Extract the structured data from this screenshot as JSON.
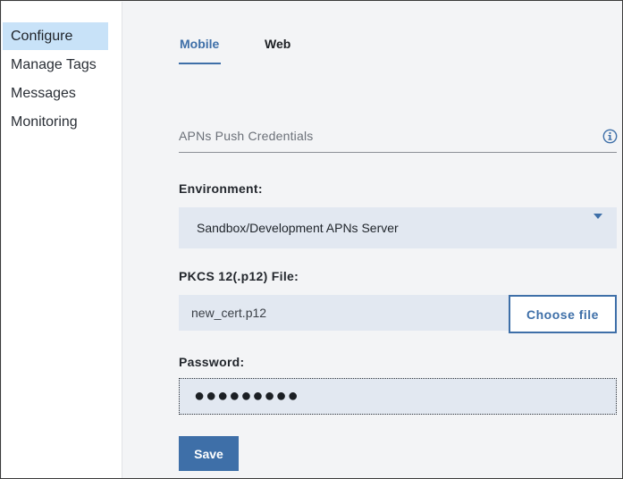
{
  "sidebar": {
    "items": [
      {
        "label": "Configure",
        "active": true
      },
      {
        "label": "Manage Tags",
        "active": false
      },
      {
        "label": "Messages",
        "active": false
      },
      {
        "label": "Monitoring",
        "active": false
      }
    ]
  },
  "tabs": [
    {
      "label": "Mobile",
      "active": true
    },
    {
      "label": "Web",
      "active": false
    }
  ],
  "section": {
    "title": "APNs Push Credentials",
    "icon": "info-icon"
  },
  "environment": {
    "label": "Environment:",
    "value": "Sandbox/Development APNs Server",
    "icon": "chevron-down-icon"
  },
  "pkcs": {
    "label": "PKCS 12(.p12) File:",
    "file_name": "new_cert.p12",
    "choose_label": "Choose file"
  },
  "password": {
    "label": "Password:",
    "value": "●●●●●●●●●"
  },
  "actions": {
    "save_label": "Save"
  },
  "colors": {
    "accent": "#3e6fa8",
    "sidebar_active": "#c8e2f8",
    "field_bg": "#e2e8f1",
    "page_bg": "#f3f4f6"
  }
}
